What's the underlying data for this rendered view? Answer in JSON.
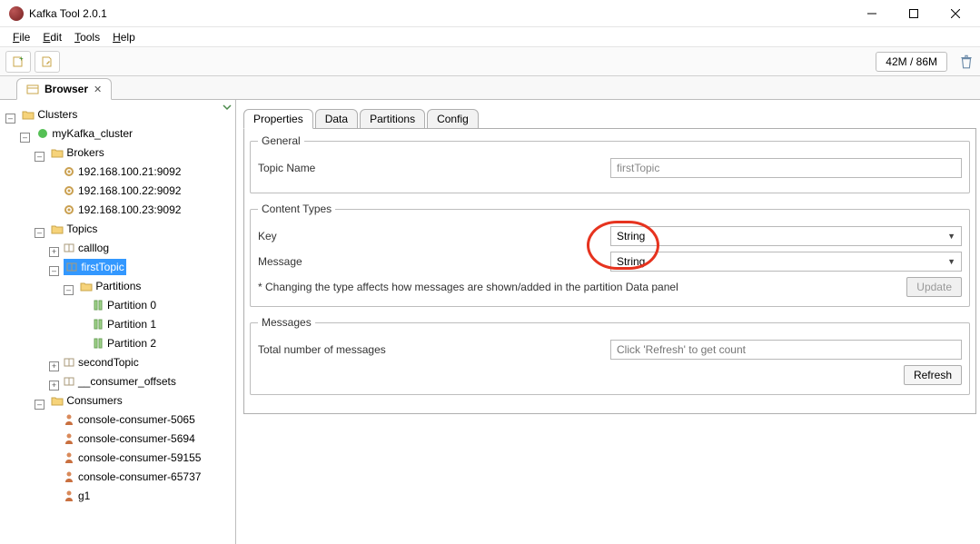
{
  "window": {
    "title": "Kafka Tool  2.0.1"
  },
  "menubar": {
    "file": "File",
    "edit": "Edit",
    "tools": "Tools",
    "help": "Help"
  },
  "toolbar": {
    "memory": "42M / 86M"
  },
  "editorTab": {
    "label": "Browser"
  },
  "tree": {
    "root": "Clusters",
    "cluster": "myKafka_cluster",
    "brokers": "Brokers",
    "broker_list": [
      "192.168.100.21:9092",
      "192.168.100.22:9092",
      "192.168.100.23:9092"
    ],
    "topics": "Topics",
    "topic_calllog": "calllog",
    "topic_first": "firstTopic",
    "partitions_label": "Partitions",
    "partition_items": [
      "Partition 0",
      "Partition 1",
      "Partition 2"
    ],
    "topic_second": "secondTopic",
    "topic_offsets": "__consumer_offsets",
    "consumers": "Consumers",
    "consumer_list": [
      "console-consumer-5065",
      "console-consumer-5694",
      "console-consumer-59155",
      "console-consumer-65737",
      "g1"
    ]
  },
  "tabs": {
    "properties": "Properties",
    "data": "Data",
    "partitions": "Partitions",
    "config": "Config"
  },
  "general": {
    "legend": "General",
    "topic_label": "Topic Name",
    "topic_value": "firstTopic"
  },
  "content_types": {
    "legend": "Content Types",
    "key_label": "Key",
    "key_value": "String",
    "message_label": "Message",
    "message_value": "String",
    "note": "* Changing the type affects how messages are shown/added in the partition Data panel",
    "update_btn": "Update"
  },
  "messages": {
    "legend": "Messages",
    "total_label": "Total number of messages",
    "count_placeholder": "Click 'Refresh' to get count",
    "refresh_btn": "Refresh"
  }
}
